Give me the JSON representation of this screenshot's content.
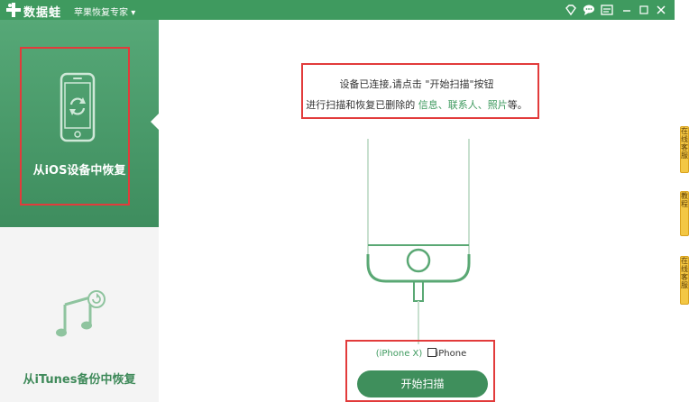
{
  "titlebar": {
    "app_name": "数据蛙",
    "subtitle": "苹果恢复专家",
    "subtitle_caret": "▾",
    "icons": [
      "diamond-icon",
      "chat-icon",
      "menu-icon",
      "minimize-icon",
      "maximize-icon",
      "close-icon"
    ]
  },
  "sidebar": {
    "ios_mode_label": "从iOS设备中恢复",
    "itunes_mode_label": "从iTunes备份中恢复"
  },
  "main": {
    "hint_line1": "设备已连接,请点击 \"开始扫描\"按钮",
    "hint_line2_prefix": "进行扫描和恢复已删除的",
    "hint_line2_items": "信息、联系人、照片",
    "hint_line2_suffix": "等。",
    "device_model": "(iPhone X)",
    "device_name": "iPhone",
    "start_button": "开始扫描"
  },
  "side_tabs": {
    "tab1": "在线客服",
    "tab2": "教程",
    "tab3": "在线客服"
  },
  "colors": {
    "brand_green": "#3f9a5f",
    "highlight": "#e23b3b",
    "side_tab": "#f3c744"
  }
}
